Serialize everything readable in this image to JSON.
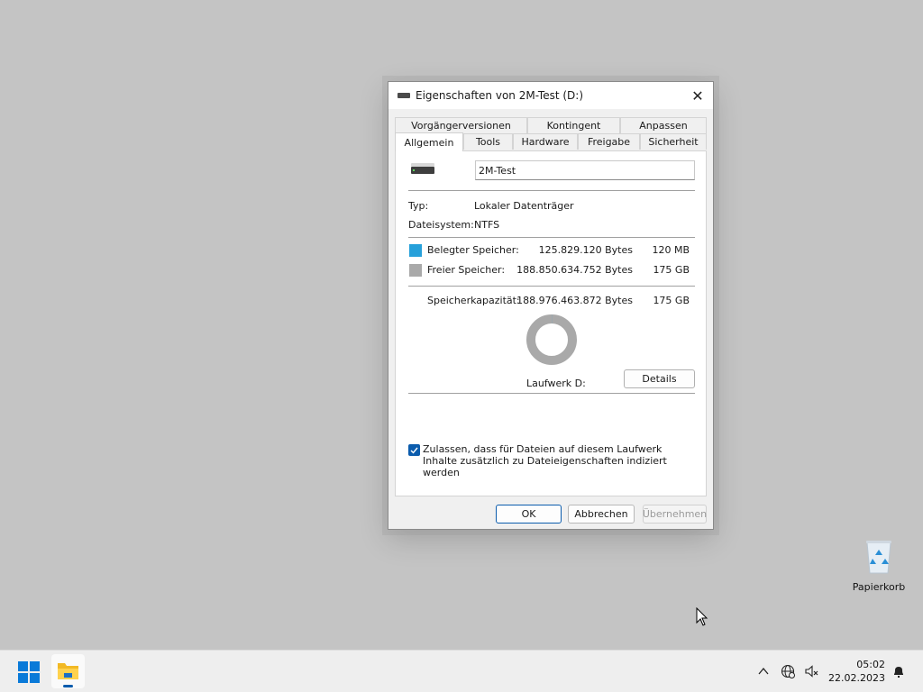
{
  "dialog": {
    "title": "Eigenschaften von 2M-Test (D:)",
    "close_symbol": "✕",
    "tabs_row1": [
      "Vorgängerversionen",
      "Kontingent",
      "Anpassen"
    ],
    "tabs_row2": [
      "Allgemein",
      "Tools",
      "Hardware",
      "Freigabe",
      "Sicherheit"
    ],
    "active_tab": "Allgemein",
    "general": {
      "name_value": "2M-Test",
      "type_label": "Typ:",
      "type_value": "Lokaler Datenträger",
      "fs_label": "Dateisystem:",
      "fs_value": "NTFS",
      "used_label": "Belegter Speicher:",
      "used_bytes": "125.829.120 Bytes",
      "used_size": "120 MB",
      "free_label": "Freier Speicher:",
      "free_bytes": "188.850.634.752 Bytes",
      "free_size": "175 GB",
      "capacity_label": "Speicherkapazität:",
      "capacity_bytes": "188.976.463.872 Bytes",
      "capacity_size": "175 GB",
      "drive_label": "Laufwerk D:",
      "details_button": "Details",
      "index_checkbox_text": "Zulassen, dass für Dateien auf diesem Laufwerk Inhalte zusätzlich zu Dateieigenschaften indiziert werden",
      "index_checked": true,
      "used_color": "#26a0da",
      "free_color": "#a9a9a9"
    },
    "buttons": {
      "ok": "OK",
      "cancel": "Abbrechen",
      "apply": "Übernehmen"
    }
  },
  "desktop": {
    "recycle_bin_label": "Papierkorb"
  },
  "taskbar": {
    "time": "05:02",
    "date": "22.02.2023",
    "icons": [
      "windows-start-icon",
      "file-explorer-icon",
      "chevron-up-icon",
      "network-icon",
      "speaker-muted-icon",
      "notification-icon"
    ]
  }
}
